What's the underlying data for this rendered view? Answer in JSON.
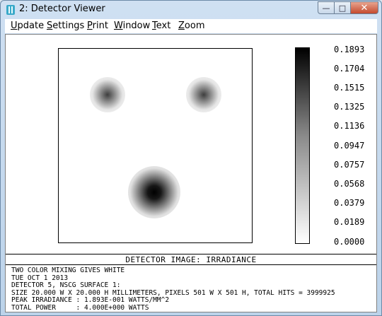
{
  "window": {
    "title": "2: Detector Viewer"
  },
  "menu": [
    {
      "label": "Update",
      "accel": "U",
      "rest": "pdate"
    },
    {
      "label": "Settings",
      "accel": "S",
      "rest": "ettings"
    },
    {
      "label": "Print",
      "accel": "P",
      "rest": "rint"
    },
    {
      "label": "Window",
      "accel": "W",
      "rest": "indow"
    },
    {
      "label": "Text",
      "accel": "T",
      "rest": "ext"
    },
    {
      "label": "Zoom",
      "accel": "Z",
      "rest": "oom"
    }
  ],
  "window_buttons": {
    "minimize": "—",
    "maximize": "□",
    "close": "✕"
  },
  "colorbar": {
    "labels": [
      "0.1893",
      "0.1704",
      "0.1515",
      "0.1325",
      "0.1136",
      "0.0947",
      "0.0757",
      "0.0568",
      "0.0379",
      "0.0189",
      "0.0000"
    ],
    "gradient": "black-to-white"
  },
  "detector": {
    "caption": "DETECTOR IMAGE: IRRADIANCE",
    "spots": [
      {
        "name": "upper-left",
        "intensity": 0.08
      },
      {
        "name": "upper-right",
        "intensity": 0.08
      },
      {
        "name": "bottom-center",
        "intensity": 0.1893
      }
    ]
  },
  "info": {
    "line1": "TWO COLOR MIXING GIVES WHITE",
    "line2": "TUE OCT 1 2013",
    "line3": "DETECTOR 5, NSCG SURFACE 1:",
    "line4": "SIZE 20.000 W X 20.000 H MILLIMETERS, PIXELS 501 W X 501 H, TOTAL HITS = 3999925",
    "line5": "PEAK IRRADIANCE : 1.893E-001 WATTS/MM^2",
    "line6": "TOTAL POWER     : 4.000E+000 WATTS"
  }
}
